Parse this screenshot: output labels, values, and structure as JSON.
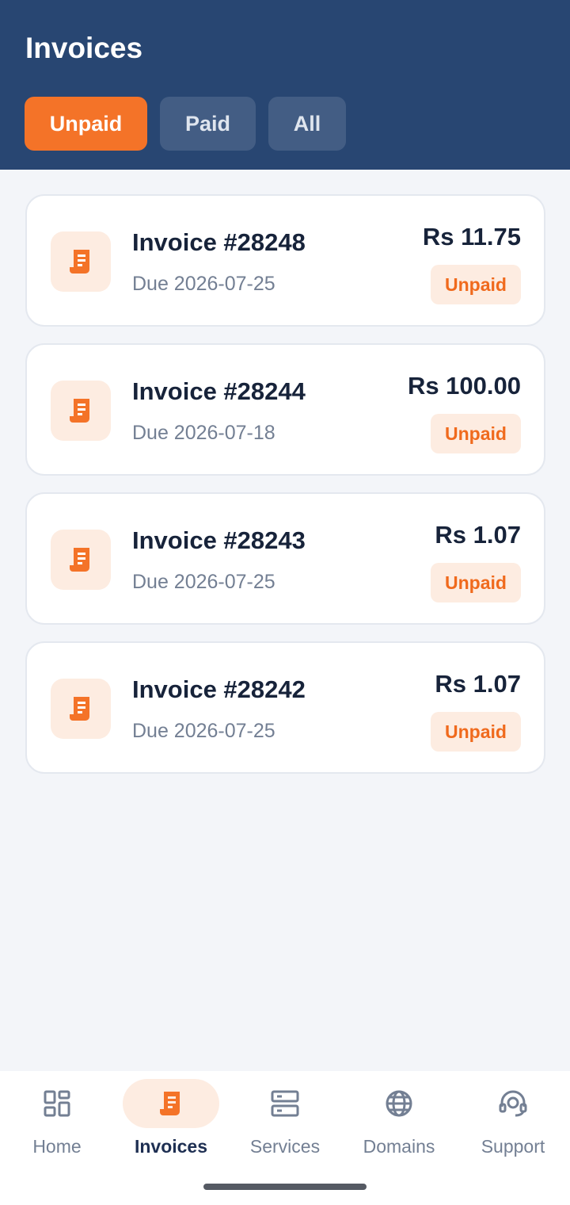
{
  "header": {
    "title": "Invoices"
  },
  "tabs": [
    {
      "label": "Unpaid",
      "active": true
    },
    {
      "label": "Paid",
      "active": false
    },
    {
      "label": "All",
      "active": false
    }
  ],
  "invoices": [
    {
      "title": "Invoice #28248",
      "due": "Due 2026-07-25",
      "amount": "Rs 11.75",
      "status": "Unpaid"
    },
    {
      "title": "Invoice #28244",
      "due": "Due 2026-07-18",
      "amount": "Rs 100.00",
      "status": "Unpaid"
    },
    {
      "title": "Invoice #28243",
      "due": "Due 2026-07-25",
      "amount": "Rs 1.07",
      "status": "Unpaid"
    },
    {
      "title": "Invoice #28242",
      "due": "Due 2026-07-25",
      "amount": "Rs 1.07",
      "status": "Unpaid"
    }
  ],
  "nav": [
    {
      "label": "Home",
      "icon": "dashboard-icon",
      "active": false
    },
    {
      "label": "Invoices",
      "icon": "receipt-icon",
      "active": true
    },
    {
      "label": "Services",
      "icon": "server-icon",
      "active": false
    },
    {
      "label": "Domains",
      "icon": "globe-icon",
      "active": false
    },
    {
      "label": "Support",
      "icon": "headset-icon",
      "active": false
    }
  ],
  "colors": {
    "header_bg": "#284672",
    "accent": "#f47328",
    "badge_bg": "#fdece1",
    "text_dark": "#17233a",
    "text_muted": "#737f93"
  }
}
